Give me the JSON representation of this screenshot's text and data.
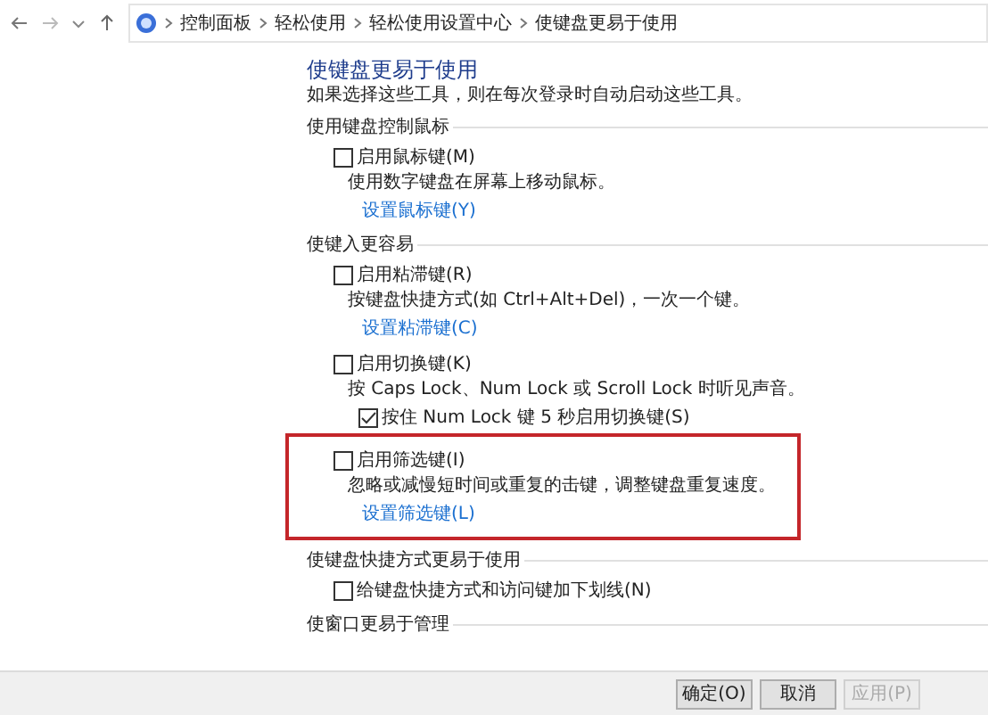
{
  "breadcrumb": [
    "控制面板",
    "轻松使用",
    "轻松使用设置中心",
    "使键盘更易于使用"
  ],
  "title": "使键盘更易于使用",
  "subtitle": "如果选择这些工具，则在每次登录时自动启动这些工具。",
  "sections": [
    {
      "heading": "使用键盘控制鼠标",
      "options": [
        {
          "label": "启用鼠标键(M)",
          "checked": false,
          "highlighted": false,
          "description": "使用数字键盘在屏幕上移动鼠标。",
          "link": "设置鼠标键(Y)"
        }
      ]
    },
    {
      "heading": "使键入更容易",
      "options": [
        {
          "label": "启用粘滞键(R)",
          "checked": false,
          "highlighted": false,
          "description": "按键盘快捷方式(如 Ctrl+Alt+Del)，一次一个键。",
          "link": "设置粘滞键(C)"
        },
        {
          "label": "启用切换键(K)",
          "checked": false,
          "highlighted": false,
          "description": "按 Caps Lock、Num Lock 或 Scroll Lock 时听见声音。",
          "sub_option": {
            "label": "按住 Num Lock 键 5 秒启用切换键(S)",
            "checked": true
          }
        },
        {
          "label": "启用筛选键(I)",
          "checked": false,
          "highlighted": true,
          "description": "忽略或减慢短时间或重复的击键，调整键盘重复速度。",
          "link": "设置筛选键(L)"
        }
      ]
    },
    {
      "heading": "使键盘快捷方式更易于使用",
      "options": [
        {
          "label": "给键盘快捷方式和访问键加下划线(N)",
          "checked": false,
          "highlighted": false
        }
      ]
    },
    {
      "heading": "使窗口更易于管理"
    }
  ],
  "buttons": [
    {
      "label": "确定(O)",
      "disabled": false
    },
    {
      "label": "取消",
      "disabled": false
    },
    {
      "label": "应用(P)",
      "disabled": true
    }
  ]
}
